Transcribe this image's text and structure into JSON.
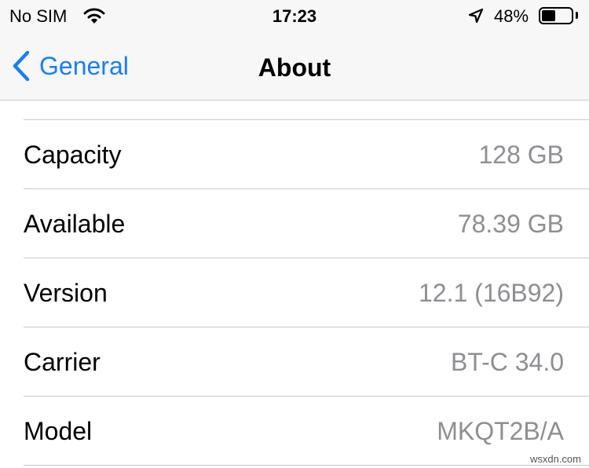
{
  "status_bar": {
    "carrier": "No SIM",
    "time": "17:23",
    "battery_percent_label": "48%",
    "battery_level": 0.48,
    "icons": [
      "wifi-icon",
      "location-icon",
      "battery-icon"
    ]
  },
  "nav": {
    "back_label": "General",
    "title": "About",
    "accent_color": "#1a7ef0"
  },
  "rows": [
    {
      "label": "Capacity",
      "value": "128 GB"
    },
    {
      "label": "Available",
      "value": "78.39 GB"
    },
    {
      "label": "Version",
      "value": "12.1 (16B92)"
    },
    {
      "label": "Carrier",
      "value": "BT-C 34.0"
    },
    {
      "label": "Model",
      "value": "MKQT2B/A"
    }
  ],
  "watermark": "wsxdn.com"
}
